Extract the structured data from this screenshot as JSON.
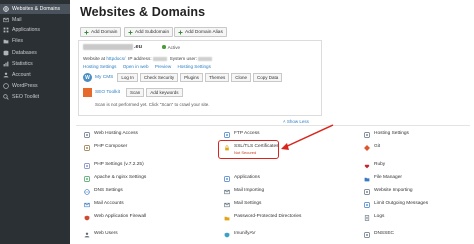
{
  "sidebar": {
    "items": [
      {
        "label": "Websites & Domains",
        "icon": "globe-icon",
        "active": true
      },
      {
        "label": "Mail",
        "icon": "mail-icon"
      },
      {
        "label": "Applications",
        "icon": "applications-icon"
      },
      {
        "label": "Files",
        "icon": "folder-icon"
      },
      {
        "label": "Databases",
        "icon": "database-icon"
      },
      {
        "label": "Statistics",
        "icon": "statistics-icon"
      },
      {
        "label": "Account",
        "icon": "account-icon"
      },
      {
        "label": "WordPress",
        "icon": "wordpress-icon"
      },
      {
        "label": "SEO Toolkit",
        "icon": "seo-toolkit-icon"
      }
    ]
  },
  "main": {
    "title": "Websites & Domains",
    "toolbar": [
      {
        "label": "Add Domain",
        "icon": "plus-icon"
      },
      {
        "label": "Add Subdomain",
        "icon": "plus-icon"
      },
      {
        "label": "Add Domain Alias",
        "icon": "plus-icon"
      }
    ],
    "domain": {
      "tld": ".eu",
      "status": "Active",
      "website_at_prefix": "Website at",
      "httpdocs": "httpdocs/",
      "ip_label": "IP address:",
      "system_user_label": "System user:",
      "hosting_links": [
        "Hosting Settings",
        "Open in web",
        "Preview",
        "Hosting Settings"
      ]
    },
    "cms": {
      "label": "My CMS",
      "buttons": [
        "Log In",
        "Check Security",
        "Plugins",
        "Themes",
        "Clone",
        "Copy Data"
      ]
    },
    "seo": {
      "label": "SEO Toolkit",
      "buttons": [
        "Scan",
        "Add keywords"
      ],
      "note": "Scan is not performed yet. Click \"Scan\" to crawl your site."
    },
    "show_less": "˄ Show Less",
    "tools": {
      "col1": [
        {
          "label": "Web Hosting Access",
          "icon": "web-hosting-access-icon",
          "color": "#5b6b7b"
        },
        {
          "label": "PHP Composer",
          "icon": "php-composer-icon",
          "color": "#8a6d3b"
        },
        {
          "label": "PHP Settings (v.7.2.25)",
          "icon": "php-settings-icon",
          "color": "#6f7ab8"
        },
        {
          "label": "Apache & nginx Settings",
          "icon": "apache-nginx-icon",
          "color": "#3a9b5c"
        },
        {
          "label": "DNS Settings",
          "icon": "dns-settings-icon",
          "color": "#3b78c2"
        },
        {
          "label": "Mail Accounts",
          "icon": "mail-accounts-icon",
          "color": "#3b78c2"
        },
        {
          "label": "Web Application Firewall",
          "icon": "firewall-icon",
          "color": "#d04a2f"
        },
        {
          "label": "Web Users",
          "icon": "web-users-icon",
          "color": "#5b6b7b"
        }
      ],
      "col2": [
        {
          "label": "FTP Access",
          "icon": "ftp-access-icon",
          "color": "#3b78c2"
        },
        {
          "label": "SSL/TLS Certificates",
          "sub": "Not Secured",
          "icon": "ssl-lock-icon",
          "color": "#e2a317"
        },
        {
          "label": "Applications",
          "icon": "applications-icon",
          "color": "#3b78c2"
        },
        {
          "label": "Mail Importing",
          "icon": "mail-importing-icon",
          "color": "#5b6b7b"
        },
        {
          "label": "Mail Settings",
          "icon": "mail-settings-icon",
          "color": "#5b6b7b"
        },
        {
          "label": "Password-Protected Directories",
          "icon": "password-directories-icon",
          "color": "#e2a317"
        },
        {
          "label": "ImunifyAV",
          "icon": "imunifyav-icon",
          "color": "#3aa0c9"
        }
      ],
      "col3": [
        {
          "label": "Hosting Settings",
          "icon": "hosting-settings-icon",
          "color": "#5b6b7b"
        },
        {
          "label": "Git",
          "icon": "git-icon",
          "color": "#e0542f"
        },
        {
          "label": "Ruby",
          "icon": "ruby-icon",
          "color": "#c2272d"
        },
        {
          "label": "File Manager",
          "icon": "file-manager-icon",
          "color": "#3b78c2"
        },
        {
          "label": "Website Importing",
          "icon": "website-importing-icon",
          "color": "#5b6b7b"
        },
        {
          "label": "Limit Outgoing Messages",
          "icon": "limit-messages-icon",
          "color": "#3b78c2"
        },
        {
          "label": "Logs",
          "icon": "logs-icon",
          "color": "#5b6b7b"
        },
        {
          "label": "DNSSEC",
          "icon": "dnssec-icon",
          "color": "#5b6b7b"
        }
      ]
    }
  },
  "colors": {
    "sidebar_bg": "#2b3035",
    "link": "#2d7fc1",
    "highlight": "#d9251d",
    "warning": "#c23b22"
  }
}
